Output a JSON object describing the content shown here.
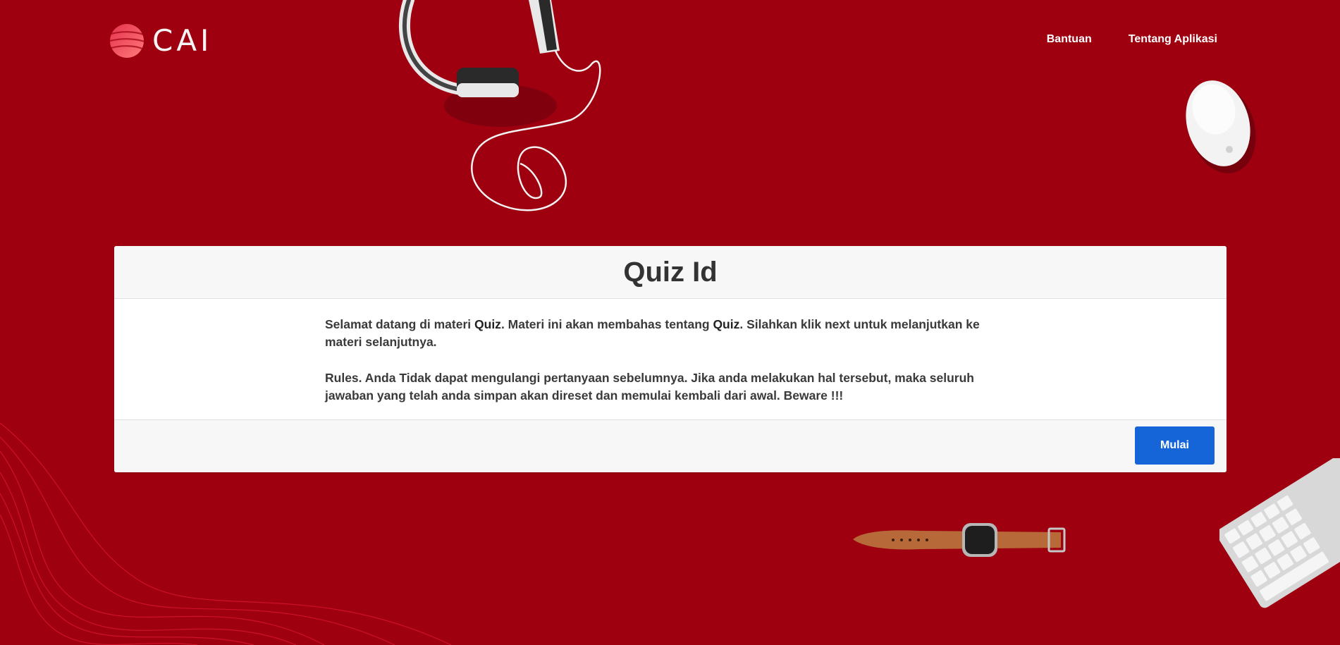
{
  "header": {
    "logo_text": "CAI",
    "nav": [
      {
        "label": "Bantuan"
      },
      {
        "label": "Tentang Aplikasi"
      }
    ]
  },
  "card": {
    "title": "Quiz Id",
    "intro": {
      "before": "Selamat datang di materi ",
      "topic1": "Quiz",
      "middle": ". Materi ini akan membahas tentang ",
      "topic2": "Quiz",
      "after": ". Silahkan klik next untuk melanjutkan ke materi selanjutnya."
    },
    "rules": "Rules. Anda Tidak dapat mengulangi pertanyaan sebelumnya. Jika anda melakukan hal tersebut, maka seluruh jawaban yang telah anda simpan akan direset dan memulai kembali dari awal. Beware !!!",
    "start_button": "Mulai"
  },
  "colors": {
    "background": "#9e0010",
    "primary_button": "#1565d8"
  },
  "icons": [
    "logo-globe-icon",
    "headphones-icon",
    "mouse-icon",
    "watch-icon",
    "keyboard-icon"
  ]
}
